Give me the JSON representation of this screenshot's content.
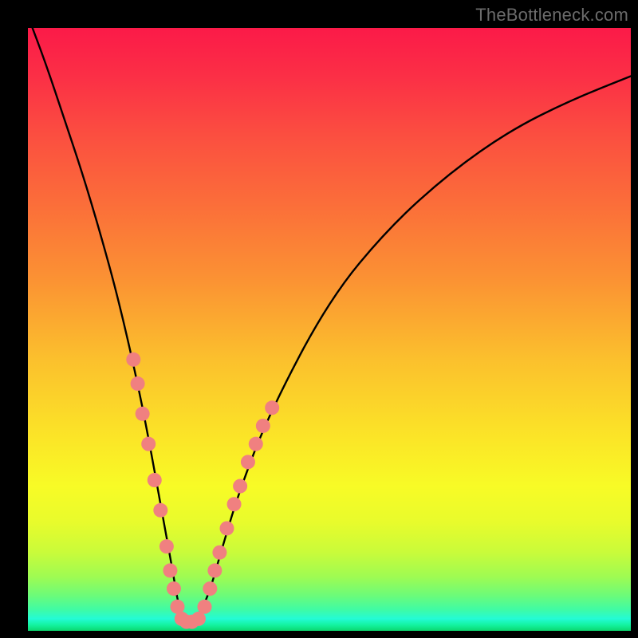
{
  "watermark": "TheBottleneck.com",
  "chart_data": {
    "type": "line",
    "title": "",
    "xlabel": "",
    "ylabel": "",
    "xlim": [
      0,
      100
    ],
    "ylim": [
      0,
      100
    ],
    "grid": false,
    "annotations": [],
    "series": [
      {
        "name": "bottleneck-curve",
        "x": [
          0,
          3,
          6,
          9,
          12,
          15,
          18,
          20,
          22,
          24,
          25,
          26,
          27,
          28,
          30,
          32,
          35,
          40,
          50,
          60,
          70,
          80,
          90,
          100
        ],
        "values": [
          102,
          94,
          85,
          76,
          66,
          55,
          42,
          32,
          21,
          10,
          4,
          2,
          1.5,
          2,
          6,
          13,
          23,
          36,
          55,
          67,
          76,
          83,
          88,
          92
        ]
      }
    ],
    "markers": {
      "name": "highlight-dots",
      "color": "#f08080",
      "points": [
        {
          "x": 17.5,
          "y": 45
        },
        {
          "x": 18.2,
          "y": 41
        },
        {
          "x": 19.0,
          "y": 36
        },
        {
          "x": 20.0,
          "y": 31
        },
        {
          "x": 21.0,
          "y": 25
        },
        {
          "x": 22.0,
          "y": 20
        },
        {
          "x": 23.0,
          "y": 14
        },
        {
          "x": 23.6,
          "y": 10
        },
        {
          "x": 24.2,
          "y": 7
        },
        {
          "x": 24.8,
          "y": 4
        },
        {
          "x": 25.5,
          "y": 2
        },
        {
          "x": 26.3,
          "y": 1.5
        },
        {
          "x": 27.2,
          "y": 1.5
        },
        {
          "x": 28.3,
          "y": 2
        },
        {
          "x": 29.3,
          "y": 4
        },
        {
          "x": 30.2,
          "y": 7
        },
        {
          "x": 31.0,
          "y": 10
        },
        {
          "x": 31.8,
          "y": 13
        },
        {
          "x": 33.0,
          "y": 17
        },
        {
          "x": 34.2,
          "y": 21
        },
        {
          "x": 35.2,
          "y": 24
        },
        {
          "x": 36.5,
          "y": 28
        },
        {
          "x": 37.8,
          "y": 31
        },
        {
          "x": 39.0,
          "y": 34
        },
        {
          "x": 40.5,
          "y": 37
        }
      ]
    }
  }
}
